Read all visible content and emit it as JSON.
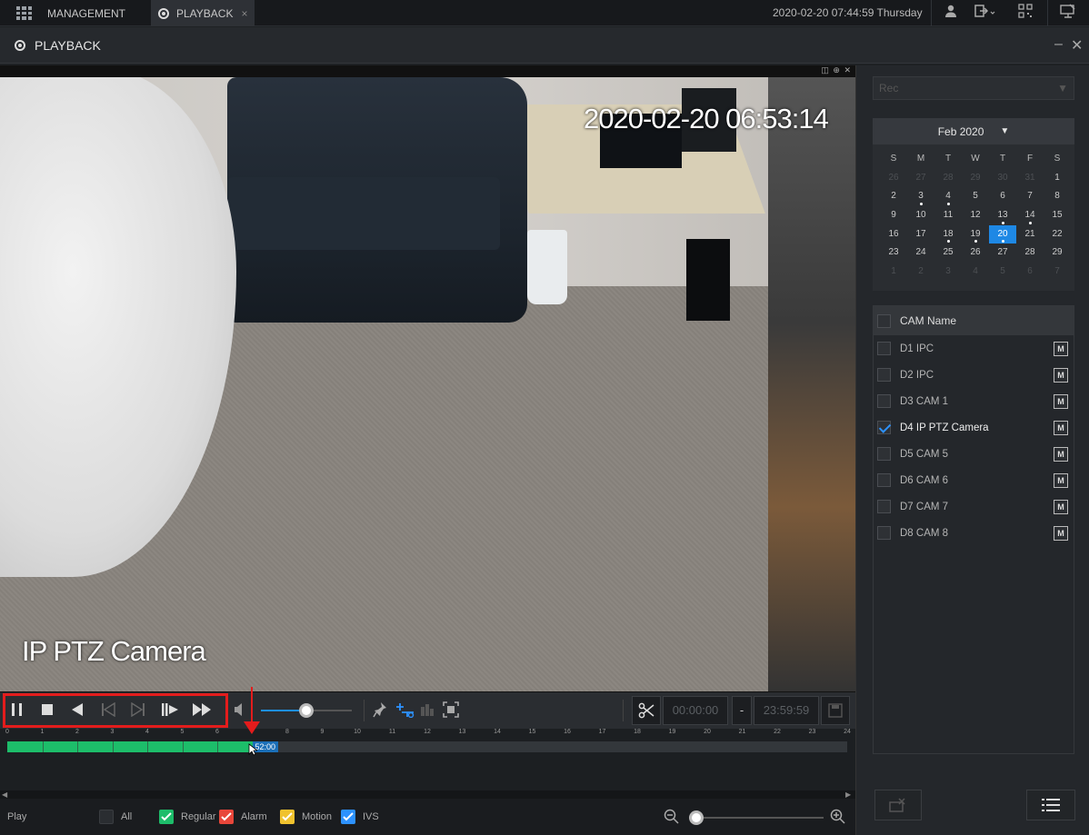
{
  "topbar": {
    "tabs": [
      {
        "label": "MANAGEMENT",
        "icon": "grid-icon"
      },
      {
        "label": "PLAYBACK",
        "icon": "film-reel-icon",
        "close": "×"
      }
    ],
    "datetime": "2020-02-20 07:44:59 Thursday",
    "icons": [
      "user-icon",
      "logout-icon",
      "qr-code-icon",
      "monitor-icon"
    ]
  },
  "titlebar": {
    "title": "PLAYBACK",
    "minimize": "–",
    "close": "✕"
  },
  "video": {
    "osd_time": "2020-02-20 06:53:14",
    "osd_name": "IP PTZ Camera",
    "tools": "◫ ⊕ ✕"
  },
  "controls": {
    "clip_start": "00:00:00",
    "clip_dash": "-",
    "clip_end": "23:59:59",
    "volume_fraction": 0.5
  },
  "timeline": {
    "hours": [
      "0",
      "1",
      "2",
      "3",
      "4",
      "5",
      "6",
      "7",
      "8",
      "9",
      "10",
      "11",
      "12",
      "13",
      "14",
      "15",
      "16",
      "17",
      "18",
      "19",
      "20",
      "21",
      "22",
      "23",
      "24"
    ],
    "recorded_until_hour": 7.0,
    "cursor_label": "52:00"
  },
  "bottom": {
    "play_label": "Play",
    "filters": [
      {
        "label": "All",
        "color": "#2a2d31",
        "checked": false
      },
      {
        "label": "Regular",
        "color": "#1dbd6a",
        "checked": true
      },
      {
        "label": "Alarm",
        "color": "#e8463a",
        "checked": true
      },
      {
        "label": "Motion",
        "color": "#f0c22e",
        "checked": true
      },
      {
        "label": "IVS",
        "color": "#2d92ff",
        "checked": true
      }
    ],
    "zoom_fraction": 0.0
  },
  "sidebar": {
    "record_type": "Rec",
    "calendar": {
      "month": "Feb 2020",
      "dow": [
        "S",
        "M",
        "T",
        "W",
        "T",
        "F",
        "S"
      ],
      "days": [
        [
          "26",
          "27",
          "28",
          "29",
          "30",
          "31",
          "1"
        ],
        [
          "2",
          "3",
          "4",
          "5",
          "6",
          "7",
          "8"
        ],
        [
          "9",
          "10",
          "11",
          "12",
          "13",
          "14",
          "15"
        ],
        [
          "16",
          "17",
          "18",
          "19",
          "20",
          "21",
          "22"
        ],
        [
          "23",
          "24",
          "25",
          "26",
          "27",
          "28",
          "29"
        ],
        [
          "1",
          "2",
          "3",
          "4",
          "5",
          "6",
          "7"
        ]
      ]
    },
    "cam_header": "CAM Name",
    "cams": [
      {
        "name": "D1 IPC",
        "checked": false
      },
      {
        "name": "D2 IPC",
        "checked": false
      },
      {
        "name": "D3 CAM 1",
        "checked": false
      },
      {
        "name": "D4 IP PTZ Camera",
        "checked": true
      },
      {
        "name": "D5 CAM 5",
        "checked": false
      },
      {
        "name": "D6 CAM 6",
        "checked": false
      },
      {
        "name": "D7 CAM 7",
        "checked": false
      },
      {
        "name": "D8 CAM 8",
        "checked": false
      }
    ],
    "cam_mode_label": "M"
  }
}
